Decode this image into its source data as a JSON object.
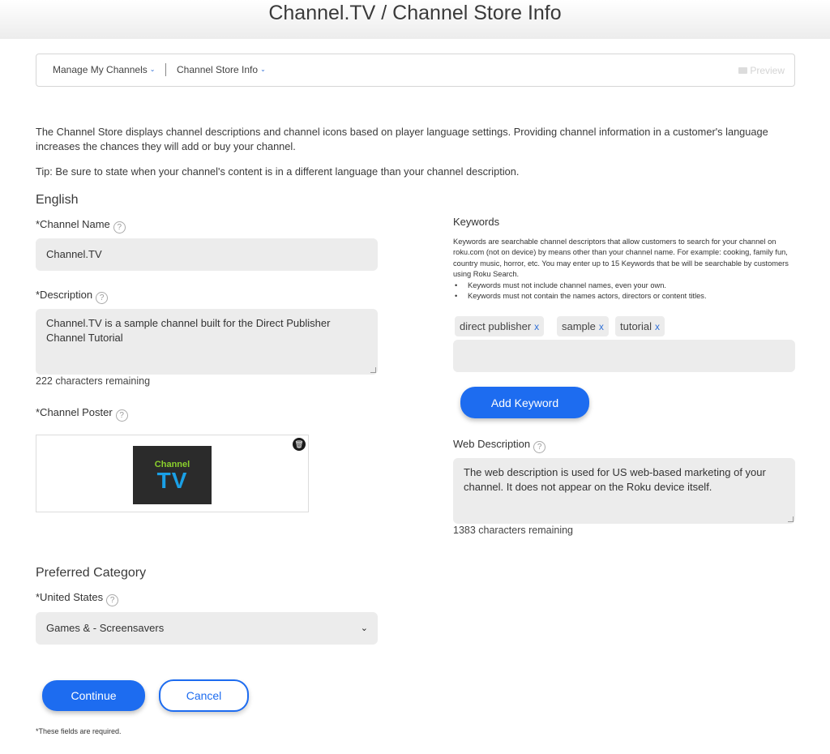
{
  "header": {
    "title": "Channel.TV / Channel Store Info"
  },
  "breadcrumb": {
    "manage_label": "Manage My Channels",
    "store_info_label": "Channel Store Info",
    "preview_label": "Preview"
  },
  "intro": {
    "text": "The Channel Store displays channel descriptions and channel icons based on player language settings. Providing channel information in a customer's language increases the chances they will add or buy your channel.",
    "tip": "Tip: Be sure to state when your channel's content is in a different language than your channel description."
  },
  "language_section": {
    "title": "English"
  },
  "channel_name": {
    "label": "*Channel Name",
    "value": "Channel.TV"
  },
  "description": {
    "label": "*Description",
    "value": "Channel.TV is a sample channel built for the Direct Publisher Channel Tutorial",
    "remaining": "222 characters remaining"
  },
  "poster": {
    "label": "*Channel Poster",
    "image_line1": "Channel",
    "image_line2": "TV"
  },
  "keywords": {
    "label": "Keywords",
    "description": "Keywords are searchable channel descriptors that allow customers to search for your channel on roku.com (not on device) by means other than your channel name. For example: cooking, family fun, country music, horror, etc. You may enter up to 15 Keywords that be will be searchable by customers using Roku Search.",
    "rules": [
      "Keywords must not include channel names, even your own.",
      "Keywords must not contain the names actors, directors or content titles."
    ],
    "chips": [
      "direct publisher",
      "sample",
      "tutorial"
    ],
    "chip_remove": "x",
    "input_value": "",
    "add_button": "Add Keyword"
  },
  "web_description": {
    "label": "Web Description",
    "value": "The web description is used for US web-based marketing of your channel. It does not appear on the Roku device itself.",
    "remaining": "1383 characters remaining"
  },
  "category": {
    "title": "Preferred Category",
    "label": "*United States",
    "selected": "Games & - Screensavers"
  },
  "actions": {
    "continue": "Continue",
    "cancel": "Cancel"
  },
  "footnote": "*These fields are required.",
  "colors": {
    "primary": "#1d6cf0",
    "field_bg": "#ececec"
  }
}
